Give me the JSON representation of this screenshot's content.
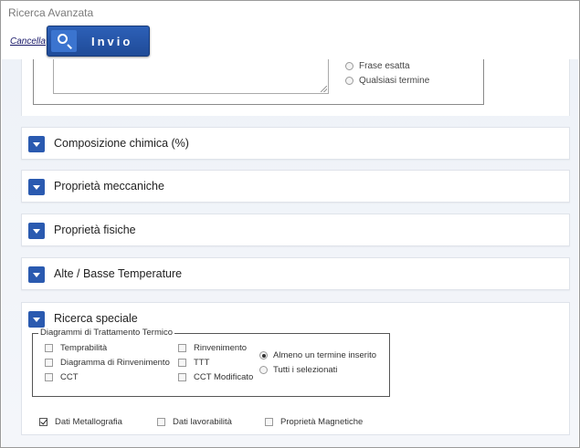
{
  "window": {
    "title": "Ricerca Avanzata"
  },
  "toolbar": {
    "cancel_label": "Cancella",
    "submit_label": "Invio"
  },
  "text_search": {
    "match_options": [
      {
        "label": "Frase esatta",
        "selected": false
      },
      {
        "label": "Qualsiasi termine",
        "selected": false
      }
    ]
  },
  "sections": [
    {
      "label": "Composizione chimica (%)"
    },
    {
      "label": "Proprietà meccaniche"
    },
    {
      "label": "Proprietà fisiche"
    },
    {
      "label": "Alte / Basse Temperature"
    }
  ],
  "special_search": {
    "label": "Ricerca speciale",
    "diagrams": {
      "legend": "Diagrammi di Trattamento Termico",
      "options": [
        {
          "label": "Temprabilità",
          "checked": false
        },
        {
          "label": "Diagramma di Rinvenimento",
          "checked": false
        },
        {
          "label": "CCT",
          "checked": false
        },
        {
          "label": "Rinvenimento",
          "checked": false
        },
        {
          "label": "TTT",
          "checked": false
        },
        {
          "label": "CCT Modificato",
          "checked": false
        }
      ],
      "match_modes": [
        {
          "label": "Almeno un termine inserito",
          "selected": true
        },
        {
          "label": "Tutti i selezionati",
          "selected": false
        }
      ]
    },
    "extra_options": [
      {
        "label": "Dati Metallografia",
        "checked": true
      },
      {
        "label": "Dati lavorabilità",
        "checked": false
      },
      {
        "label": "Proprietà Magnetiche",
        "checked": false
      }
    ]
  },
  "colors": {
    "accent": "#2a5ab0",
    "button_gradient_top": "#2d60b7",
    "button_gradient_bottom": "#1f4b98",
    "page_background": "#eef2f8"
  }
}
